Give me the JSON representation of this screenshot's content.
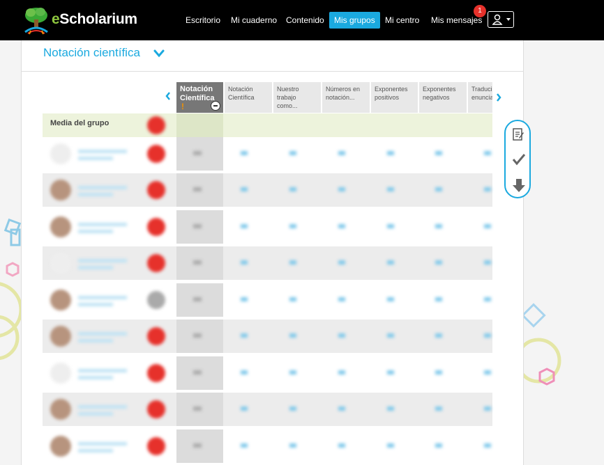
{
  "app": {
    "name_prefix": "e",
    "name_rest": "Scholarium"
  },
  "nav": {
    "items": [
      {
        "label": "Escritorio"
      },
      {
        "label": "Mi cuaderno"
      },
      {
        "label": "Contenido"
      },
      {
        "label": "Mis grupos",
        "active": true
      },
      {
        "label": "Mi centro"
      },
      {
        "label": "Mis mensajes"
      }
    ],
    "messages_badge": "1"
  },
  "section": {
    "title": "Notación científica"
  },
  "table": {
    "columns": [
      {
        "label": "Notación Científica",
        "active": true
      },
      {
        "label": "Notación Científica"
      },
      {
        "label": "Nuestro trabajo como..."
      },
      {
        "label": "Números en notación..."
      },
      {
        "label": "Exponentes positivos"
      },
      {
        "label": "Exponentes negativos"
      },
      {
        "label": "Traducir enunciados"
      }
    ],
    "group_average_label": "Media del grupo"
  },
  "colors": {
    "accent": "#1aa9df",
    "brand_green": "#8ec63f",
    "grade_red": "#e6312b"
  },
  "toolbox": {
    "icons": [
      "edit-icon",
      "check-icon",
      "download-icon"
    ]
  }
}
